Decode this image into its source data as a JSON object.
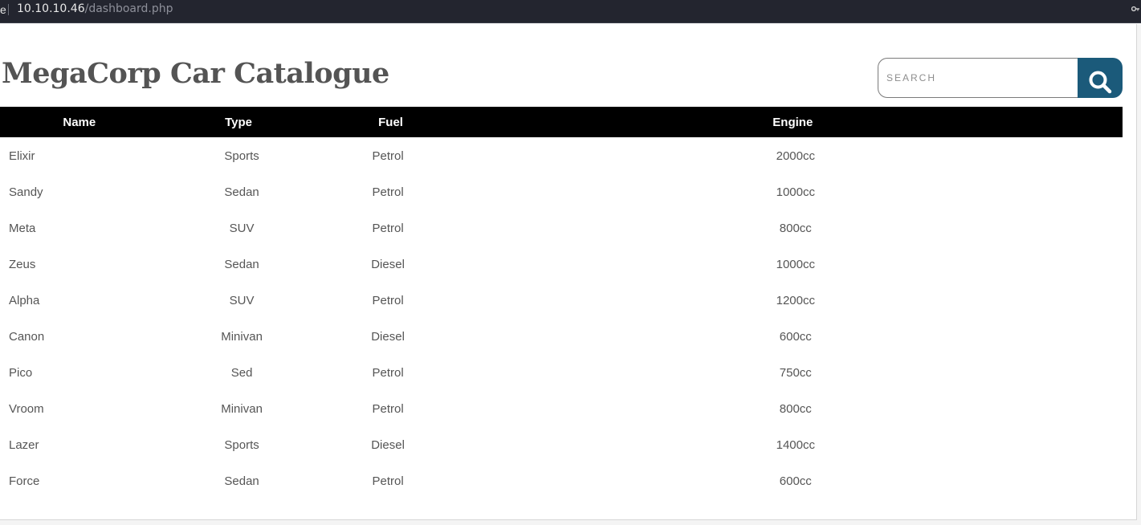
{
  "browser": {
    "url_host": "10.10.10.46",
    "url_path": "/dashboard.php",
    "edge_glyph": "e"
  },
  "page": {
    "title": "MegaCorp Car Catalogue",
    "search": {
      "placeholder": "SEARCH",
      "value": "",
      "button_icon": "search-icon",
      "button_color": "#1b5a7a"
    }
  },
  "table": {
    "columns": [
      "Name",
      "Type",
      "Fuel",
      "Engine"
    ],
    "rows": [
      {
        "name": "Elixir",
        "type": "Sports",
        "fuel": "Petrol",
        "engine": "2000cc"
      },
      {
        "name": "Sandy",
        "type": "Sedan",
        "fuel": "Petrol",
        "engine": "1000cc"
      },
      {
        "name": "Meta",
        "type": "SUV",
        "fuel": "Petrol",
        "engine": "800cc"
      },
      {
        "name": "Zeus",
        "type": "Sedan",
        "fuel": "Diesel",
        "engine": "1000cc"
      },
      {
        "name": "Alpha",
        "type": "SUV",
        "fuel": "Petrol",
        "engine": "1200cc"
      },
      {
        "name": "Canon",
        "type": "Minivan",
        "fuel": "Diesel",
        "engine": "600cc"
      },
      {
        "name": "Pico",
        "type": "Sed",
        "fuel": "Petrol",
        "engine": "750cc"
      },
      {
        "name": "Vroom",
        "type": "Minivan",
        "fuel": "Petrol",
        "engine": "800cc"
      },
      {
        "name": "Lazer",
        "type": "Sports",
        "fuel": "Diesel",
        "engine": "1400cc"
      },
      {
        "name": "Force",
        "type": "Sedan",
        "fuel": "Petrol",
        "engine": "600cc"
      }
    ]
  }
}
